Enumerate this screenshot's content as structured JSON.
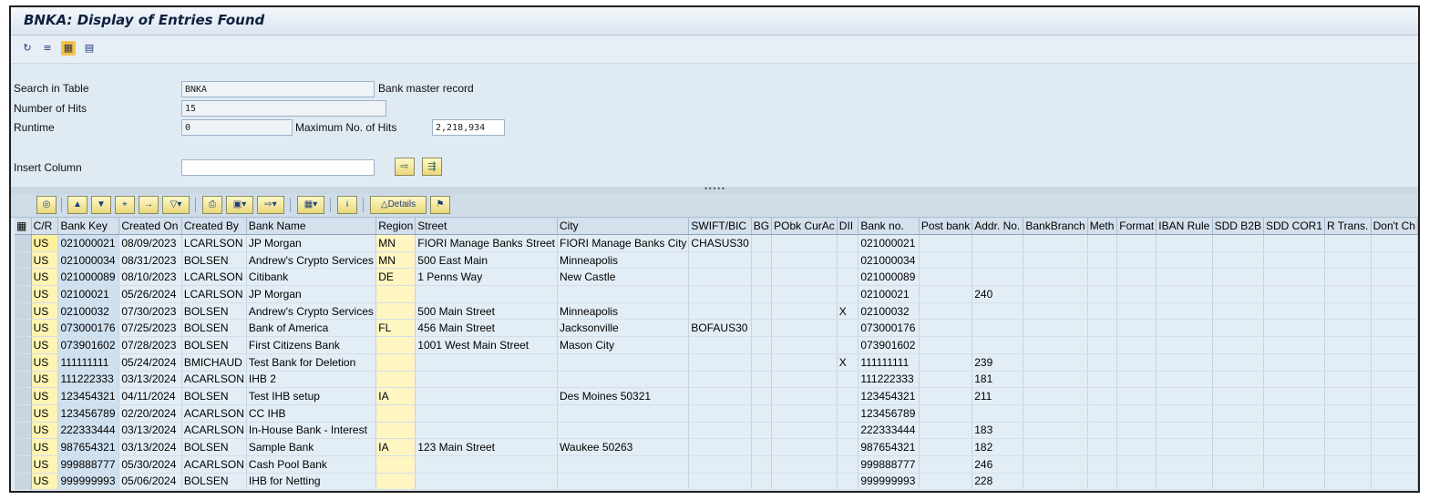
{
  "window": {
    "title": "BNKA: Display of Entries Found"
  },
  "app_toolbar": {
    "icons": [
      "refresh-icon",
      "settings-icon",
      "check-table-icon",
      "display-icon"
    ]
  },
  "header": {
    "search_label": "Search in Table",
    "search_value": "BNKA",
    "search_desc": "Bank master record",
    "hits_label": "Number of Hits",
    "hits_value": "15",
    "runtime_label": "Runtime",
    "runtime_value": "0",
    "max_hits_label": "Maximum No. of Hits",
    "max_hits_value": "2,218,934",
    "insert_column_label": "Insert Column",
    "insert_column_value": ""
  },
  "alv_toolbar": {
    "details_label": "Details",
    "icons": [
      "select-icon",
      "sort-asc-icon",
      "sort-desc-icon",
      "find-icon",
      "find-next-icon",
      "filter-icon",
      "print-icon",
      "views-icon",
      "export-icon",
      "layout-icon",
      "info-icon",
      "details-icon",
      "flag-icon"
    ]
  },
  "table": {
    "columns": [
      "C/R",
      "Bank Key",
      "Created On",
      "Created By",
      "Bank Name",
      "Region",
      "Street",
      "City",
      "SWIFT/BIC",
      "BG",
      "PObk CurAc",
      "DII",
      "Bank no.",
      "Post bank",
      "Addr. No.",
      "BankBranch",
      "Meth",
      "Format",
      "IBAN Rule",
      "SDD B2B",
      "SDD COR1",
      "R Trans.",
      "Don't Ch"
    ],
    "rows": [
      [
        "US",
        "021000021",
        "08/09/2023",
        "LCARLSON",
        "JP Morgan",
        "MN",
        "FIORI Manage Banks Street",
        "FIORI Manage Banks City",
        "CHASUS30",
        "",
        "",
        "",
        "021000021",
        "",
        "",
        "",
        "",
        "",
        "",
        "",
        "",
        "",
        ""
      ],
      [
        "US",
        "021000034",
        "08/31/2023",
        "BOLSEN",
        "Andrew's Crypto Services",
        "MN",
        "500 East Main",
        "Minneapolis",
        "",
        "",
        "",
        "",
        "021000034",
        "",
        "",
        "",
        "",
        "",
        "",
        "",
        "",
        "",
        ""
      ],
      [
        "US",
        "021000089",
        "08/10/2023",
        "LCARLSON",
        "Citibank",
        "DE",
        "1 Penns Way",
        "New Castle",
        "",
        "",
        "",
        "",
        "021000089",
        "",
        "",
        "",
        "",
        "",
        "",
        "",
        "",
        "",
        ""
      ],
      [
        "US",
        "02100021",
        "05/26/2024",
        "LCARLSON",
        "JP Morgan",
        "",
        "",
        "",
        "",
        "",
        "",
        "",
        "02100021",
        "",
        "240",
        "",
        "",
        "",
        "",
        "",
        "",
        "",
        ""
      ],
      [
        "US",
        "02100032",
        "07/30/2023",
        "BOLSEN",
        "Andrew's Crypto Services",
        "",
        "500 Main Street",
        "Minneapolis",
        "",
        "",
        "",
        "X",
        "02100032",
        "",
        "",
        "",
        "",
        "",
        "",
        "",
        "",
        "",
        ""
      ],
      [
        "US",
        "073000176",
        "07/25/2023",
        "BOLSEN",
        "Bank of America",
        "FL",
        "456 Main Street",
        "Jacksonville",
        "BOFAUS30",
        "",
        "",
        "",
        "073000176",
        "",
        "",
        "",
        "",
        "",
        "",
        "",
        "",
        "",
        ""
      ],
      [
        "US",
        "073901602",
        "07/28/2023",
        "BOLSEN",
        "First Citizens Bank",
        "",
        "1001 West Main Street",
        "Mason City",
        "",
        "",
        "",
        "",
        "073901602",
        "",
        "",
        "",
        "",
        "",
        "",
        "",
        "",
        "",
        ""
      ],
      [
        "US",
        "111111111",
        "05/24/2024",
        "BMICHAUD",
        "Test Bank for Deletion",
        "",
        "",
        "",
        "",
        "",
        "",
        "X",
        "111111111",
        "",
        "239",
        "",
        "",
        "",
        "",
        "",
        "",
        "",
        ""
      ],
      [
        "US",
        "111222333",
        "03/13/2024",
        "ACARLSON",
        "IHB 2",
        "",
        "",
        "",
        "",
        "",
        "",
        "",
        "111222333",
        "",
        "181",
        "",
        "",
        "",
        "",
        "",
        "",
        "",
        ""
      ],
      [
        "US",
        "123454321",
        "04/11/2024",
        "BOLSEN",
        "Test IHB setup",
        "IA",
        "",
        "Des Moines 50321",
        "",
        "",
        "",
        "",
        "123454321",
        "",
        "211",
        "",
        "",
        "",
        "",
        "",
        "",
        "",
        ""
      ],
      [
        "US",
        "123456789",
        "02/20/2024",
        "ACARLSON",
        "CC IHB",
        "",
        "",
        "",
        "",
        "",
        "",
        "",
        "123456789",
        "",
        "",
        "",
        "",
        "",
        "",
        "",
        "",
        "",
        ""
      ],
      [
        "US",
        "222333444",
        "03/13/2024",
        "ACARLSON",
        "In-House Bank - Interest",
        "",
        "",
        "",
        "",
        "",
        "",
        "",
        "222333444",
        "",
        "183",
        "",
        "",
        "",
        "",
        "",
        "",
        "",
        ""
      ],
      [
        "US",
        "987654321",
        "03/13/2024",
        "BOLSEN",
        "Sample Bank",
        "IA",
        "123 Main Street",
        "Waukee 50263",
        "",
        "",
        "",
        "",
        "987654321",
        "",
        "182",
        "",
        "",
        "",
        "",
        "",
        "",
        "",
        ""
      ],
      [
        "US",
        "999888777",
        "05/30/2024",
        "ACARLSON",
        "Cash Pool Bank",
        "",
        "",
        "",
        "",
        "",
        "",
        "",
        "999888777",
        "",
        "246",
        "",
        "",
        "",
        "",
        "",
        "",
        "",
        ""
      ],
      [
        "US",
        "999999993",
        "05/06/2024",
        "BOLSEN",
        "IHB for Netting",
        "",
        "",
        "",
        "",
        "",
        "",
        "",
        "999999993",
        "",
        "228",
        "",
        "",
        "",
        "",
        "",
        "",
        "",
        ""
      ]
    ]
  },
  "colors": {
    "title_text": "#0f1f3d",
    "region_bg": "#fff6c2",
    "cr_bg": "#fff4b3",
    "toolbar_button": "#e9d77a"
  }
}
